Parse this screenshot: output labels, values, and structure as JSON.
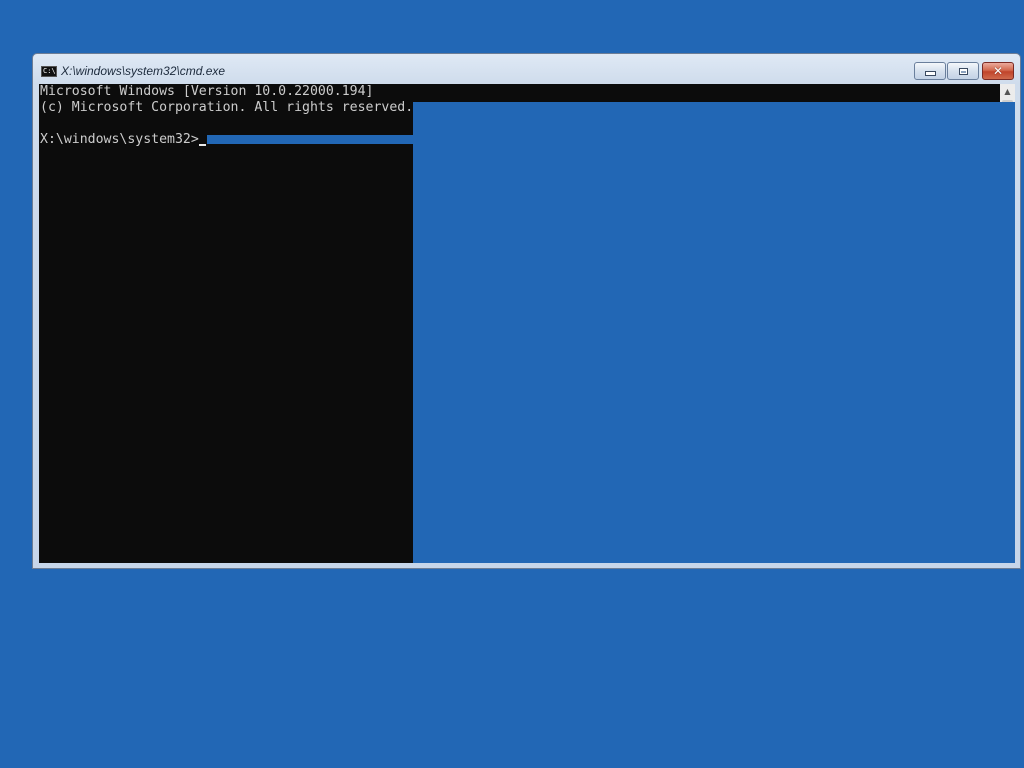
{
  "window": {
    "title": "X:\\windows\\system32\\cmd.exe",
    "icon": "cmd-icon",
    "icon_text": "C:\\"
  },
  "controls": {
    "minimize": "minimize-icon",
    "maximize": "maximize-icon",
    "close": "close-icon",
    "close_glyph": "✕"
  },
  "console": {
    "lines": [
      "Microsoft Windows [Version 10.0.22000.194]",
      "(c) Microsoft Corporation. All rights reserved.",
      ""
    ],
    "prompt": "X:\\windows\\system32>"
  },
  "scrollbar": {
    "up_arrow": "▲"
  },
  "colors": {
    "desktop": "#2267B5",
    "console_bg": "#0C0C0C",
    "console_text": "#CCCCCC",
    "close_button": "#C7472C"
  }
}
